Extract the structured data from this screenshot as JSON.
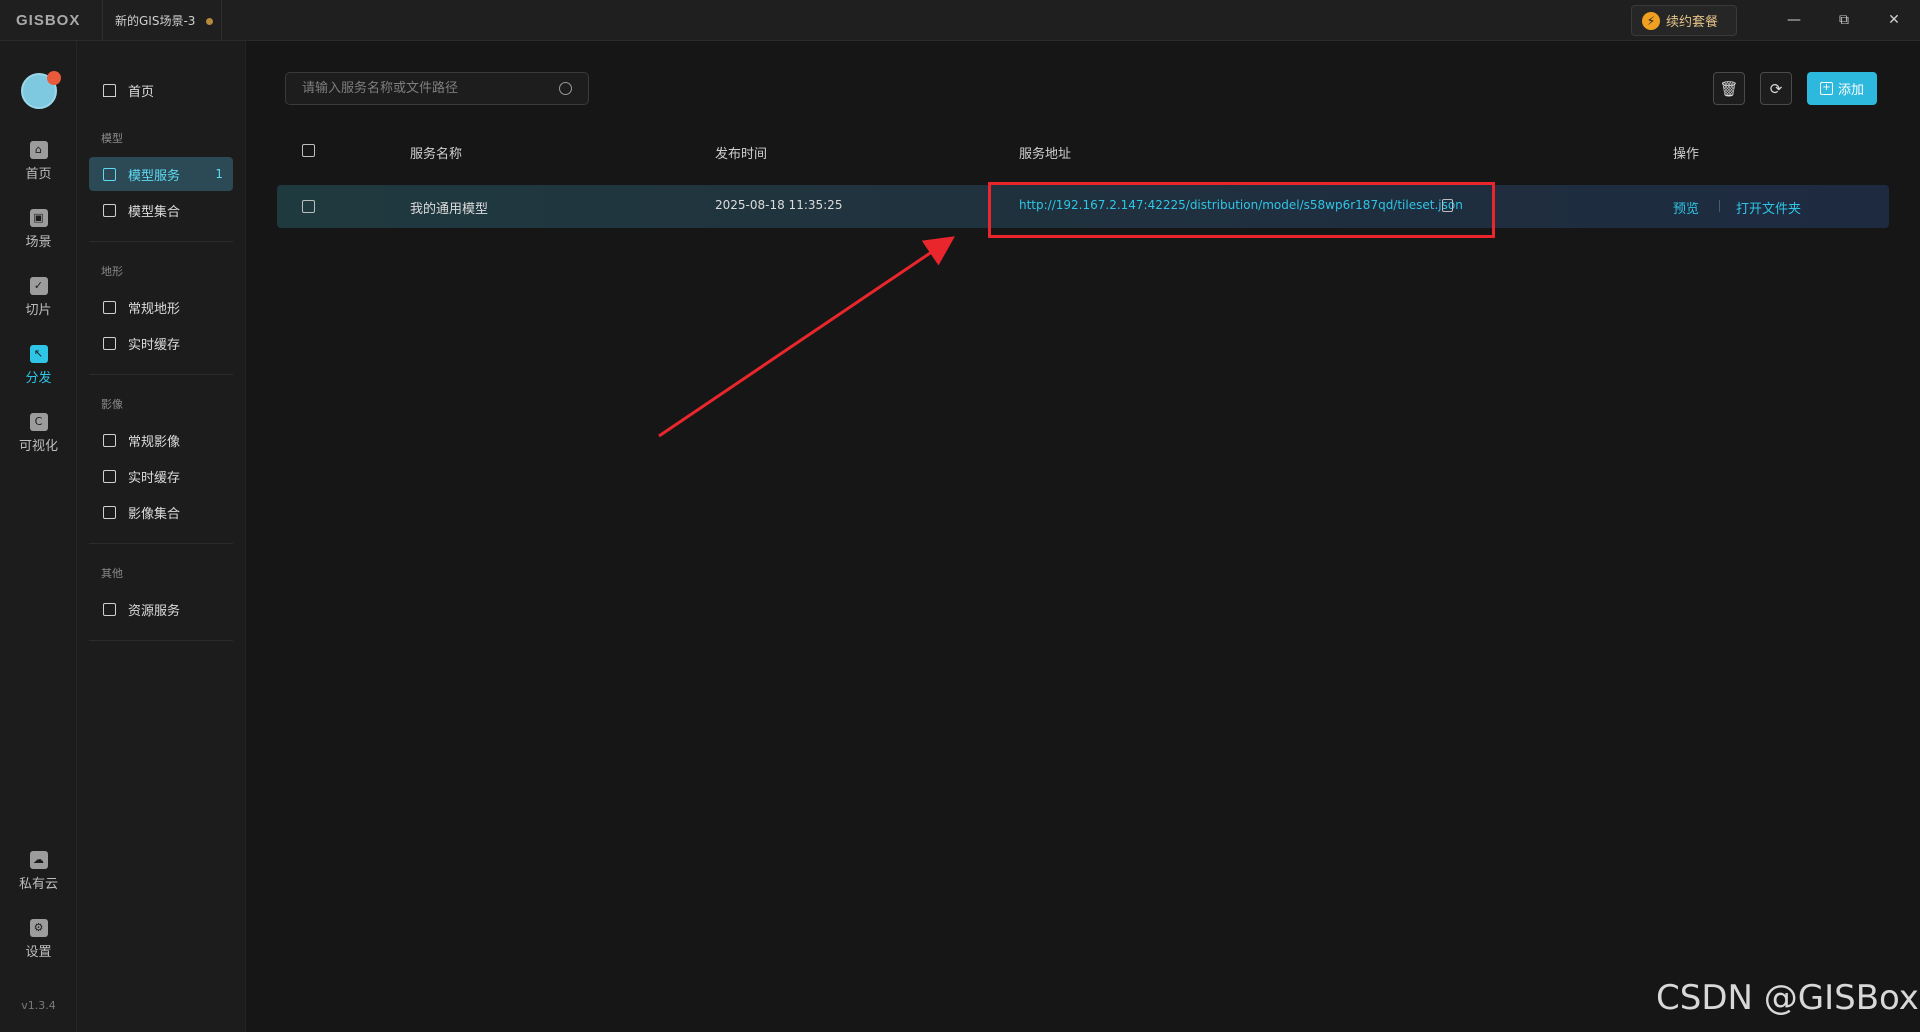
{
  "titlebar": {
    "brand": "GISBOX",
    "tab_title": "新的GIS场景-3",
    "renew_label": "续约套餐",
    "minimize": "—",
    "restore": "⧉",
    "close": "✕"
  },
  "rail": {
    "items": [
      {
        "label": "首页",
        "icon": "home-icon"
      },
      {
        "label": "场景",
        "icon": "scene-icon"
      },
      {
        "label": "切片",
        "icon": "tile-icon"
      },
      {
        "label": "分发",
        "icon": "distribute-icon",
        "active": true
      },
      {
        "label": "可视化",
        "icon": "visualize-icon"
      },
      {
        "label": "私有云",
        "icon": "private-cloud-icon"
      },
      {
        "label": "设置",
        "icon": "settings-icon"
      }
    ],
    "version": "v1.3.4"
  },
  "sidebar": {
    "home": "首页",
    "groups": {
      "model": "模型",
      "terrain": "地形",
      "imagery": "影像",
      "other": "其他"
    },
    "items": {
      "model_service": "模型服务",
      "model_service_badge": "1",
      "model_collection": "模型集合",
      "terrain_regular": "常规地形",
      "terrain_cache": "实时缓存",
      "imagery_regular": "常规影像",
      "imagery_cache": "实时缓存",
      "imagery_collection": "影像集合",
      "resource_service": "资源服务"
    }
  },
  "toolbar": {
    "search_placeholder": "请输入服务名称或文件路径",
    "add_label": "添加"
  },
  "table": {
    "headers": {
      "name": "服务名称",
      "time": "发布时间",
      "address": "服务地址",
      "actions": "操作"
    },
    "rows": [
      {
        "name": "我的通用模型",
        "time": "2025-08-18 11:35:25",
        "address": "http://192.167.2.147:42225/distribution/model/s58wp6r187qd/tileset.json",
        "action_preview": "预览",
        "action_open_folder": "打开文件夹"
      }
    ]
  },
  "watermark": "CSDN @GISBox",
  "colors": {
    "accent": "#2ec5e6",
    "highlight": "#e8262c",
    "add_button": "#2db8dd"
  }
}
